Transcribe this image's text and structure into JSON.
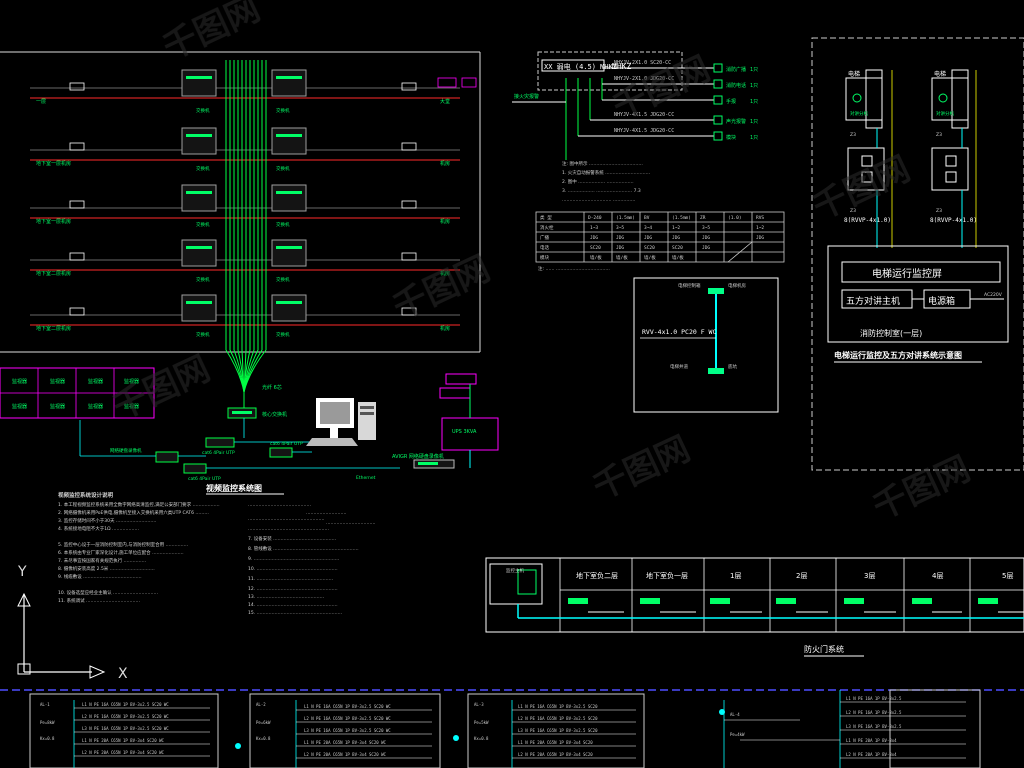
{
  "drawing": {
    "title_cctv": "视频监控系统图",
    "title_elevator": "电梯运行监控及五方对讲系统示意图",
    "title_fire_room": "消防控制室(一层)",
    "title_broadcast": "防火门系统",
    "elevator_monitor_screen": "电梯运行监控屏",
    "five_party_host": "五方对讲主机",
    "power_box": "电源箱",
    "cable_label_1": "RVV-4x1.0 PC20 F WC",
    "cable_spec_left": "8(RVVP-4x1.0)",
    "cable_spec_right": "8(RVVP-4x1.0)",
    "cabinet_label": "MHKZ",
    "car_left": "电梯",
    "car_right": "电梯"
  },
  "floors": [
    "地下室负二层",
    "地下室负一层",
    "1层",
    "2层",
    "3层",
    "4层",
    "5层"
  ],
  "cable_rows": [
    {
      "spec": "NHYJV-2X1.0 SC20-CC"
    },
    {
      "spec": "NHYJV-2X1.0 JDG20-CC"
    },
    {
      "spec": "NHYJV-4X1.5 JDG20-CC"
    },
    {
      "spec": "NHYJV-4X1.5 JDG20-CC"
    }
  ],
  "ucs": {
    "y": "Y",
    "x": "X"
  },
  "colors": {
    "background": "#000000",
    "green": "#00ff00",
    "red": "#ff2020",
    "cyan": "#00ffff",
    "magenta": "#ff00ff",
    "white": "#ffffff",
    "yellow": "#ffff00",
    "grey": "#9a9a9a"
  }
}
